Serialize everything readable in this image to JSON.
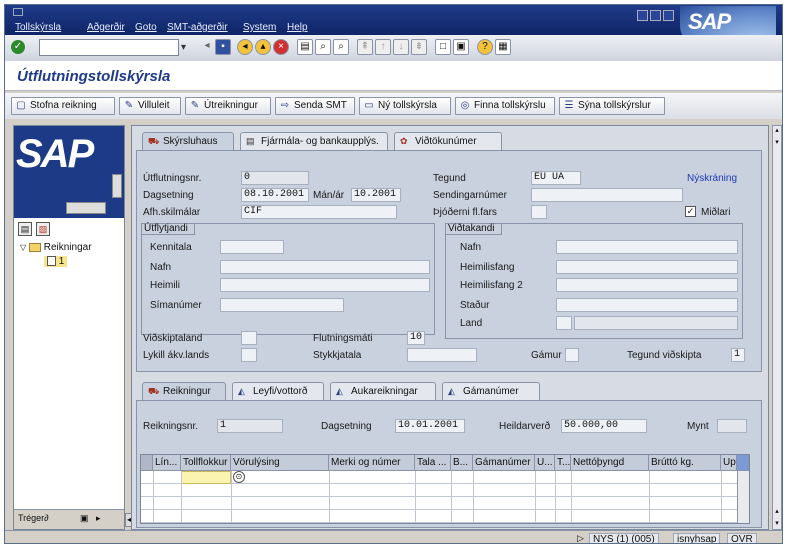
{
  "menu": [
    "Tollskýrsla",
    "Aðgerðir",
    "Goto",
    "SMT-aðgerðir",
    "System",
    "Help"
  ],
  "brand": "SAP",
  "window_title": "Útflutningstollskýrsla",
  "app_toolbar": [
    "Stofna reikning",
    "Villuleit",
    "Útreikningur",
    "Senda SMT",
    "Ný tollskýrsla",
    "Finna tollskýrslu",
    "Sýna tollskýrslur"
  ],
  "tree": {
    "root": "Reikningar",
    "child": "1"
  },
  "left_footer": "Tréger∂",
  "tabs_top": [
    "Skýrsluhaus",
    "Fjármála- og bankaupplýs.",
    "Viðtökunúmer"
  ],
  "header": {
    "utflutningsnr_label": "Útflutningsnr.",
    "utflutningsnr": "0",
    "dagsetning_label": "Dagsetning",
    "dagsetning": "08.10.2001",
    "manar_label": "Mán/ár",
    "manar": "10.2001",
    "afhskil_label": "Afh.skilmálar",
    "afhskil": "CIF",
    "tegund_label": "Tegund",
    "tegund": "EU UA",
    "nyskraning": "Nýskráning",
    "sendingarnumer_label": "Sendingarnúmer",
    "thjoderni_label": "Þjóðerni fl.fars",
    "midlari_label": "Miðlari"
  },
  "utflytjandi": {
    "title": "Útflytjandi",
    "kennitala": "Kennitala",
    "nafn": "Nafn",
    "heimili": "Heimili",
    "simanumer": "Símanúmer"
  },
  "vidtakandi": {
    "title": "Viðtakandi",
    "nafn": "Nafn",
    "heimilisfang": "Heimilisfang",
    "heimilisfang2": "Heimilisfang 2",
    "stadur": "Staður",
    "land": "Land"
  },
  "lower_fields": {
    "vidskiptaland": "Viðskiptaland",
    "lykill": "Lykill ákv.lands",
    "flutningsmati_label": "Flutningsmáti",
    "flutningsmati": "10",
    "stykkjatala": "Stykkjatala",
    "gamur": "Gámur",
    "tegund_vidskipta_label": "Tegund viðskipta",
    "tegund_vidskipta": "1"
  },
  "tabs_bottom": [
    "Reikningur",
    "Leyfi/vottorð",
    "Aukareikningar",
    "Gámanúmer"
  ],
  "reikningur": {
    "nr_label": "Reikningsnr.",
    "nr": "1",
    "dags_label": "Dagsetning",
    "dags": "10.01.2001",
    "heildarverd_label": "Heildarverð",
    "heildarverd": "50.000,00",
    "mynt_label": "Mynt"
  },
  "table_columns": [
    "Lín...",
    "Tollflokkur",
    "Vörulýsing",
    "Merki og númer",
    "Tala ...",
    "B...",
    "Gámanúmer",
    "U...",
    "T...",
    "Nettóþyngd",
    "Brúttó kg.",
    "Up"
  ],
  "status": {
    "system": "NYS (1) (005)",
    "server": "isnyhsap",
    "mode": "OVR"
  }
}
